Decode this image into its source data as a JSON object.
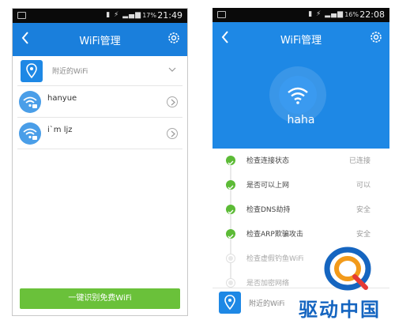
{
  "left_phone": {
    "status": {
      "signal_icons": "▮ ⚡ ▂▄▆",
      "battery": "17%",
      "time": "21:49"
    },
    "title": "WiFi管理",
    "recent_label": "附近的WiFi",
    "networks": [
      {
        "ssid": "hanyue",
        "icon": "wifi-lock-icon"
      },
      {
        "ssid": "i`m ljz",
        "icon": "wifi-lock-icon"
      }
    ],
    "action_button": "一键识别免费WiFi"
  },
  "right_phone": {
    "status": {
      "signal_icons": "▮ ⚡ ▂▄▆",
      "battery": "16%",
      "time": "22:08"
    },
    "title": "WiFi管理",
    "connected_ssid": "haha",
    "checks": [
      {
        "name": "检查连接状态",
        "status": "已连接",
        "done": true
      },
      {
        "name": "是否可以上网",
        "status": "可以",
        "done": true
      },
      {
        "name": "检查DNS劫持",
        "status": "安全",
        "done": true
      },
      {
        "name": "检查ARP欺骗攻击",
        "status": "安全",
        "done": true
      },
      {
        "name": "检查虚假钓鱼WiFi",
        "status": "",
        "done": false
      },
      {
        "name": "是否加密网络",
        "status": "",
        "done": false
      }
    ],
    "footer_label": "附近的WiFi"
  },
  "watermark": {
    "text": "驱动中国"
  },
  "colors": {
    "header_blue": "#1e88e5",
    "green": "#6ac13a",
    "check_green": "#5cbb36"
  }
}
